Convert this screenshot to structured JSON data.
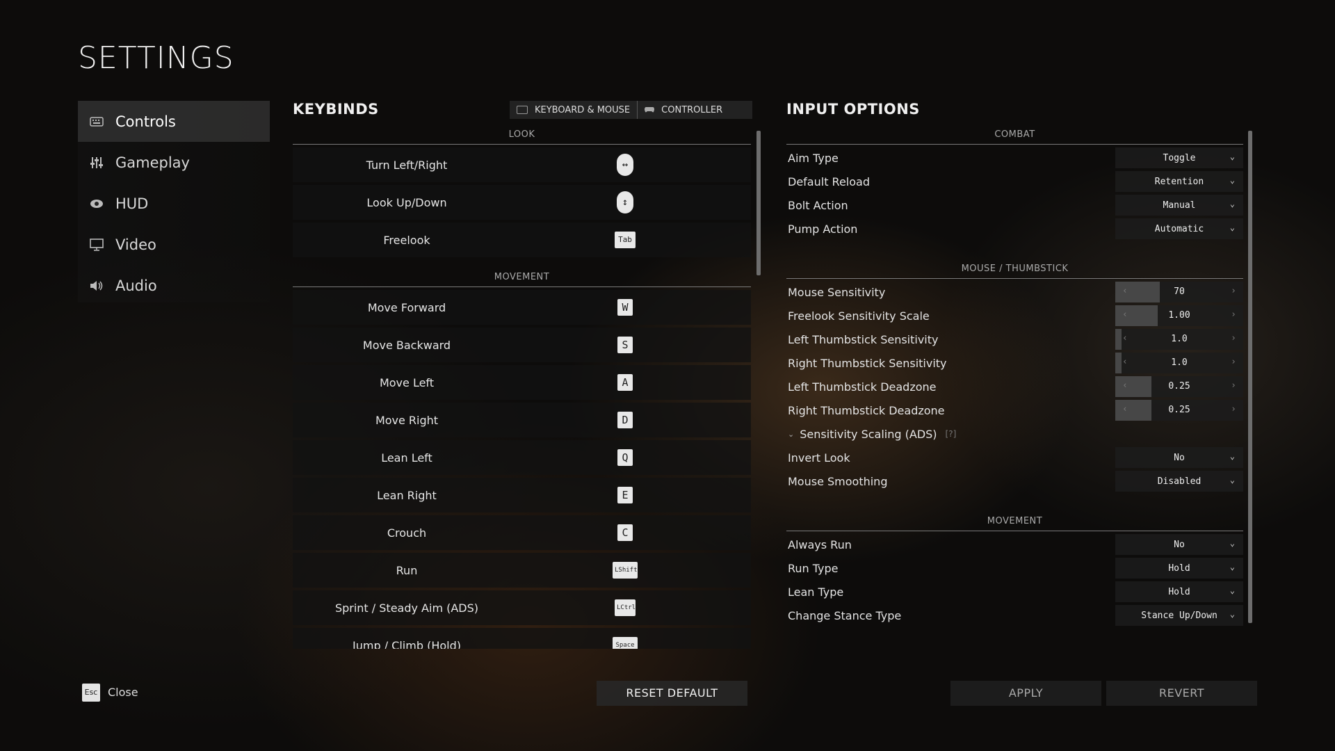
{
  "header": {
    "title": "SETTINGS"
  },
  "sidebar": {
    "items": [
      {
        "label": "Controls",
        "icon": "keyboard-icon",
        "active": true
      },
      {
        "label": "Gameplay",
        "icon": "sliders-icon"
      },
      {
        "label": "HUD",
        "icon": "eye-icon"
      },
      {
        "label": "Video",
        "icon": "monitor-icon"
      },
      {
        "label": "Audio",
        "icon": "speaker-icon"
      }
    ]
  },
  "keybinds": {
    "title": "KEYBINDS",
    "tabs": [
      {
        "label": "KEYBOARD & MOUSE",
        "icon": "keyboard-icon"
      },
      {
        "label": "CONTROLLER",
        "icon": "gamepad-icon"
      }
    ],
    "look_label": "LOOK",
    "movement_label": "MOVEMENT",
    "look": [
      {
        "action": "Turn Left/Right",
        "key": "↔"
      },
      {
        "action": "Look Up/Down",
        "key": "↕"
      },
      {
        "action": "Freelook",
        "key": "Tab"
      }
    ],
    "movement": [
      {
        "action": "Move Forward",
        "key": "W"
      },
      {
        "action": "Move Backward",
        "key": "S"
      },
      {
        "action": "Move Left",
        "key": "A"
      },
      {
        "action": "Move Right",
        "key": "D"
      },
      {
        "action": "Lean Left",
        "key": "Q"
      },
      {
        "action": "Lean Right",
        "key": "E"
      },
      {
        "action": "Crouch",
        "key": "C"
      },
      {
        "action": "Run",
        "key": "LShift"
      },
      {
        "action": "Sprint / Steady Aim (ADS)",
        "key": "LCtrl"
      },
      {
        "action": "Jump / Climb (Hold)",
        "key": "Space"
      }
    ]
  },
  "input_options": {
    "title": "INPUT OPTIONS",
    "combat_label": "COMBAT",
    "combat": [
      {
        "label": "Aim Type",
        "value": "Toggle"
      },
      {
        "label": "Default Reload",
        "value": "Retention"
      },
      {
        "label": "Bolt Action",
        "value": "Manual"
      },
      {
        "label": "Pump Action",
        "value": "Automatic"
      }
    ],
    "mouse_label": "MOUSE / THUMBSTICK",
    "mouse_sliders": [
      {
        "label": "Mouse Sensitivity",
        "value": "70",
        "fill": 0.35
      },
      {
        "label": "Freelook Sensitivity Scale",
        "value": "1.00",
        "fill": 0.33
      },
      {
        "label": "Left Thumbstick Sensitivity",
        "value": "1.0",
        "fill": 0.05
      },
      {
        "label": "Right Thumbstick Sensitivity",
        "value": "1.0",
        "fill": 0.05
      },
      {
        "label": "Left Thumbstick Deadzone",
        "value": "0.25",
        "fill": 0.28
      },
      {
        "label": "Right Thumbstick Deadzone",
        "value": "0.25",
        "fill": 0.28
      }
    ],
    "sensitivity_scaling": {
      "label": "Sensitivity Scaling (ADS)",
      "help": "[?]"
    },
    "mouse_dropdowns": [
      {
        "label": "Invert Look",
        "value": "No"
      },
      {
        "label": "Mouse Smoothing",
        "value": "Disabled"
      }
    ],
    "movement_label": "MOVEMENT",
    "movement": [
      {
        "label": "Always Run",
        "value": "No"
      },
      {
        "label": "Run Type",
        "value": "Hold"
      },
      {
        "label": "Lean Type",
        "value": "Hold"
      },
      {
        "label": "Change Stance Type",
        "value": "Stance Up/Down"
      }
    ]
  },
  "footer": {
    "esc_key": "Esc",
    "close_label": "Close",
    "reset_label": "RESET DEFAULT",
    "apply_label": "APPLY",
    "revert_label": "REVERT"
  }
}
